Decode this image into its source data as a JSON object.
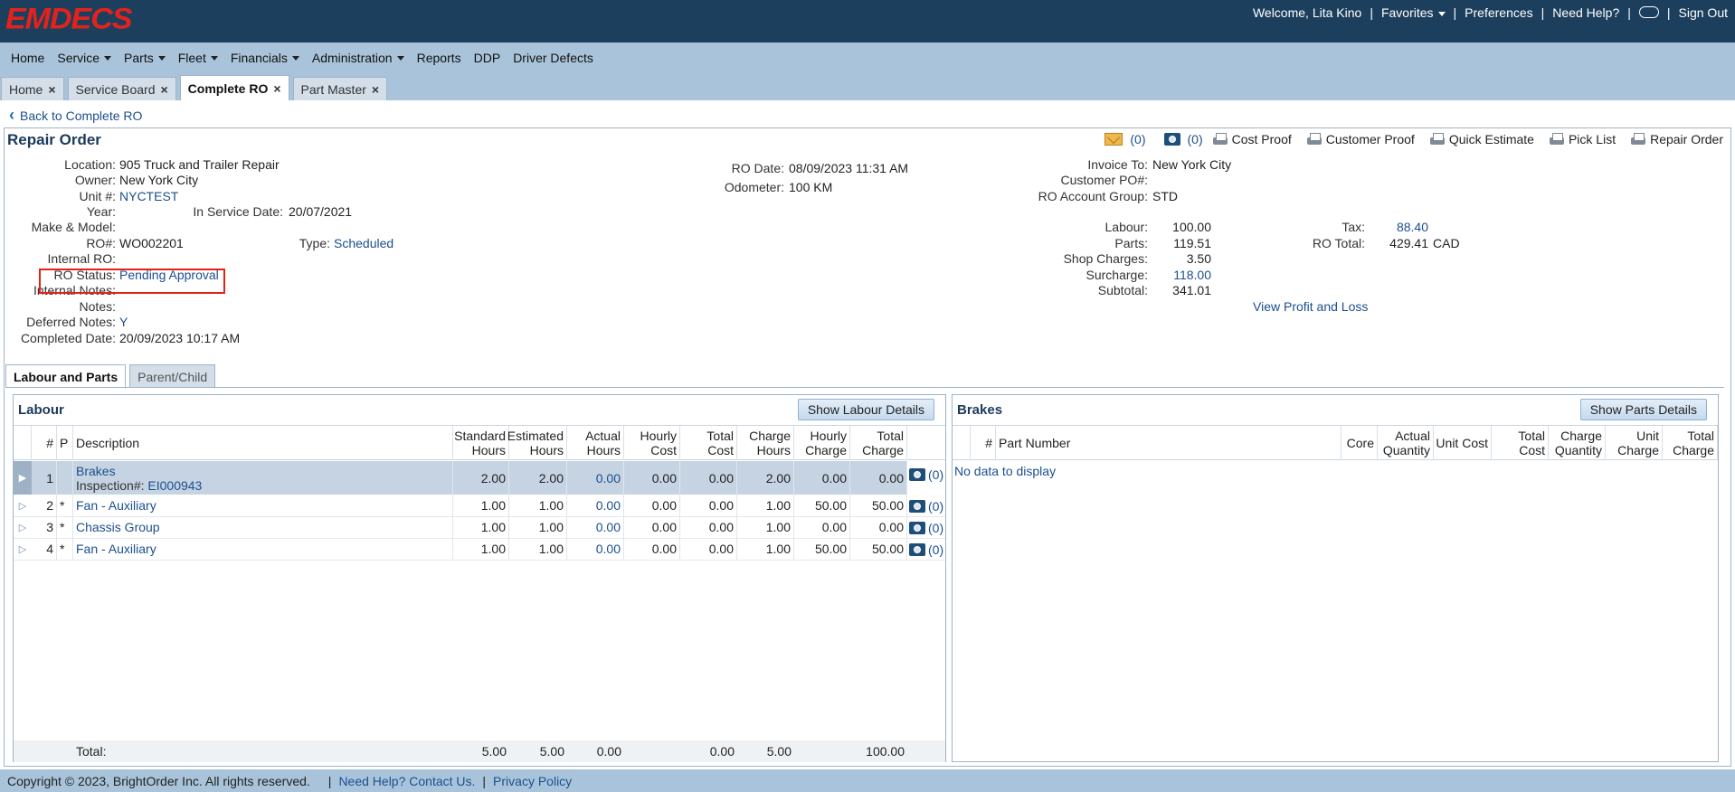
{
  "header": {
    "logo": "EMDECS",
    "welcome": "Welcome, Lita Kino",
    "favorites": "Favorites",
    "preferences": "Preferences",
    "need_help": "Need Help?",
    "sign_out": "Sign Out"
  },
  "menu": {
    "home": "Home",
    "service": "Service",
    "parts": "Parts",
    "fleet": "Fleet",
    "financials": "Financials",
    "administration": "Administration",
    "reports": "Reports",
    "ddp": "DDP",
    "driver_defects": "Driver Defects"
  },
  "tabs": {
    "home": "Home",
    "service_board": "Service Board",
    "complete_ro": "Complete RO",
    "part_master": "Part Master"
  },
  "back_link": "Back to Complete RO",
  "ro": {
    "title": "Repair Order",
    "location_label": "Location:",
    "location": "905 Truck and Trailer Repair",
    "owner_label": "Owner:",
    "owner": "New York City",
    "unit_label": "Unit #:",
    "unit": "NYCTEST",
    "year_label": "Year:",
    "in_service_label": "In Service Date:",
    "in_service": "20/07/2021",
    "make_model_label": "Make & Model:",
    "ro_num_label": "RO#:",
    "ro_num": "WO002201",
    "type_label": "Type:",
    "type": "Scheduled",
    "internal_ro_label": "Internal RO:",
    "status_label": "RO Status:",
    "status": "Pending Approval",
    "internal_notes_label": "Internal Notes:",
    "notes_label": "Notes:",
    "deferred_notes_label": "Deferred Notes:",
    "deferred_notes": "Y",
    "completed_label": "Completed Date:",
    "completed": "20/09/2023 10:17 AM",
    "ro_date_label": "RO Date:",
    "ro_date": "08/09/2023 11:31 AM",
    "odometer_label": "Odometer:",
    "odometer": "100  KM",
    "invoice_to_label": "Invoice To:",
    "invoice_to": "New York City",
    "customer_po_label": "Customer PO#:",
    "account_group_label": "RO Account Group:",
    "account_group": "STD",
    "labour_label": "Labour:",
    "labour": "100.00",
    "parts_label": "Parts:",
    "parts": "119.51",
    "shop_label": "Shop Charges:",
    "shop": "3.50",
    "surcharge_label": "Surcharge:",
    "surcharge": "118.00",
    "subtotal_label": "Subtotal:",
    "subtotal": "341.01",
    "tax_label": "Tax:",
    "tax": "88.40",
    "total_label": "RO Total:",
    "total": "429.41",
    "currency": "CAD",
    "profit_loss": "View Profit and Loss"
  },
  "actions": {
    "email_count": "(0)",
    "photo_count": "(0)",
    "cost_proof": "Cost Proof",
    "customer_proof": "Customer Proof",
    "quick_estimate": "Quick Estimate",
    "pick_list": "Pick List",
    "repair_order": "Repair Order"
  },
  "subtabs": {
    "labour_parts": "Labour and Parts",
    "parent_child": "Parent/Child"
  },
  "labour": {
    "title": "Labour",
    "details_button": "Show Labour Details",
    "headers": {
      "num": "#",
      "p": "P",
      "description": "Description",
      "std_hours_1": "Standard",
      "std_hours_2": "Hours",
      "est_hours_1": "Estimated",
      "est_hours_2": "Hours",
      "act_hours_1": "Actual",
      "act_hours_2": "Hours",
      "hourly_cost_1": "Hourly",
      "hourly_cost_2": "Cost",
      "total_cost_1": "Total",
      "total_cost_2": "Cost",
      "charge_hours_1": "Charge",
      "charge_hours_2": "Hours",
      "hourly_charge_1": "Hourly",
      "hourly_charge_2": "Charge",
      "total_charge_1": "Total",
      "total_charge_2": "Charge"
    },
    "rows": [
      {
        "num": "1",
        "p": "",
        "description": "Brakes",
        "sub": "Inspection#:",
        "sub_link": "EI000943",
        "std": "2.00",
        "est": "2.00",
        "act": "0.00",
        "hcost": "0.00",
        "tcost": "0.00",
        "chours": "2.00",
        "hcharge": "0.00",
        "tcharge": "0.00",
        "photos": "(0)"
      },
      {
        "num": "2",
        "p": "*",
        "description": "Fan - Auxiliary",
        "std": "1.00",
        "est": "1.00",
        "act": "0.00",
        "hcost": "0.00",
        "tcost": "0.00",
        "chours": "1.00",
        "hcharge": "50.00",
        "tcharge": "50.00",
        "photos": "(0)"
      },
      {
        "num": "3",
        "p": "*",
        "description": "Chassis Group",
        "std": "1.00",
        "est": "1.00",
        "act": "0.00",
        "hcost": "0.00",
        "tcost": "0.00",
        "chours": "1.00",
        "hcharge": "0.00",
        "tcharge": "0.00",
        "photos": "(0)"
      },
      {
        "num": "4",
        "p": "*",
        "description": "Fan - Auxiliary",
        "std": "1.00",
        "est": "1.00",
        "act": "0.00",
        "hcost": "0.00",
        "tcost": "0.00",
        "chours": "1.00",
        "hcharge": "50.00",
        "tcharge": "50.00",
        "photos": "(0)"
      }
    ],
    "total": {
      "label": "Total:",
      "std": "5.00",
      "est": "5.00",
      "act": "0.00",
      "tcost": "0.00",
      "chours": "5.00",
      "tcharge": "100.00"
    }
  },
  "parts_panel": {
    "title": "Brakes",
    "details_button": "Show Parts Details",
    "headers": {
      "num": "#",
      "part_number": "Part Number",
      "core": "Core",
      "actual_qty_1": "Actual",
      "actual_qty_2": "Quantity",
      "unit_cost": "Unit Cost",
      "total_cost_1": "Total",
      "total_cost_2": "Cost",
      "charge_qty_1": "Charge",
      "charge_qty_2": "Quantity",
      "unit_charge_1": "Unit",
      "unit_charge_2": "Charge",
      "total_charge_1": "Total",
      "total_charge_2": "Charge"
    },
    "empty": "No data to display"
  },
  "footer": {
    "copyright": "Copyright © 2023, BrightOrder Inc. All rights reserved.",
    "contact": "Need Help? Contact Us.",
    "privacy": "Privacy Policy"
  }
}
